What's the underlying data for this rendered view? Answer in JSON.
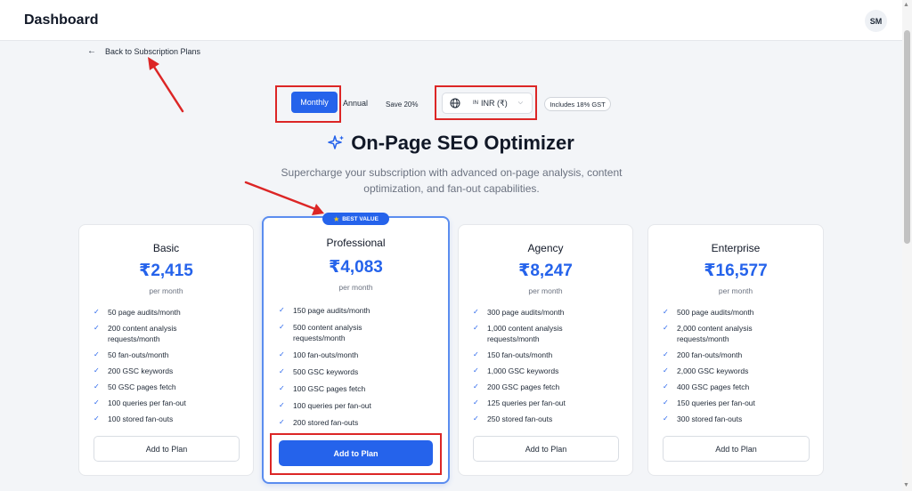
{
  "app": {
    "title": "Dashboard",
    "user_initials": "SM"
  },
  "nav": {
    "back_label": "Back to Subscription Plans",
    "back_icon": "arrow-left-icon"
  },
  "billing": {
    "monthly_label": "Monthly",
    "annual_label": "Annual",
    "save_label": "Save 20%",
    "selected": "Monthly",
    "currency_code": "IN",
    "currency_value": "INR (₹)",
    "gst_label": "Includes 18% GST"
  },
  "header": {
    "title": "On-Page SEO Optimizer",
    "subtitle": "Supercharge your subscription with advanced on-page analysis, content optimization, and fan-out capabilities."
  },
  "colors": {
    "accent": "#2563eb",
    "annotation": "#dc2626",
    "badge_star": "#facc15"
  },
  "badge": {
    "label": "BEST VALUE"
  },
  "plans": [
    {
      "name": "Basic",
      "price": "₹2,415",
      "period": "per month",
      "button": "Add to Plan",
      "features": [
        "50 page audits/month",
        "200 content analysis requests/month",
        "50 fan-outs/month",
        "200 GSC keywords",
        "50 GSC pages fetch",
        "100 queries per fan-out",
        "100 stored fan-outs"
      ]
    },
    {
      "name": "Professional",
      "price": "₹4,083",
      "period": "per month",
      "button": "Add to Plan",
      "features": [
        "150 page audits/month",
        "500 content analysis requests/month",
        "100 fan-outs/month",
        "500 GSC keywords",
        "100 GSC pages fetch",
        "100 queries per fan-out",
        "200 stored fan-outs"
      ]
    },
    {
      "name": "Agency",
      "price": "₹8,247",
      "period": "per month",
      "button": "Add to Plan",
      "features": [
        "300 page audits/month",
        "1,000 content analysis requests/month",
        "150 fan-outs/month",
        "1,000 GSC keywords",
        "200 GSC pages fetch",
        "125 queries per fan-out",
        "250 stored fan-outs"
      ]
    },
    {
      "name": "Enterprise",
      "price": "₹16,577",
      "period": "per month",
      "button": "Add to Plan",
      "features": [
        "500 page audits/month",
        "2,000 content analysis requests/month",
        "200 fan-outs/month",
        "2,000 GSC keywords",
        "400 GSC pages fetch",
        "150 queries per fan-out",
        "300 stored fan-outs"
      ]
    }
  ]
}
